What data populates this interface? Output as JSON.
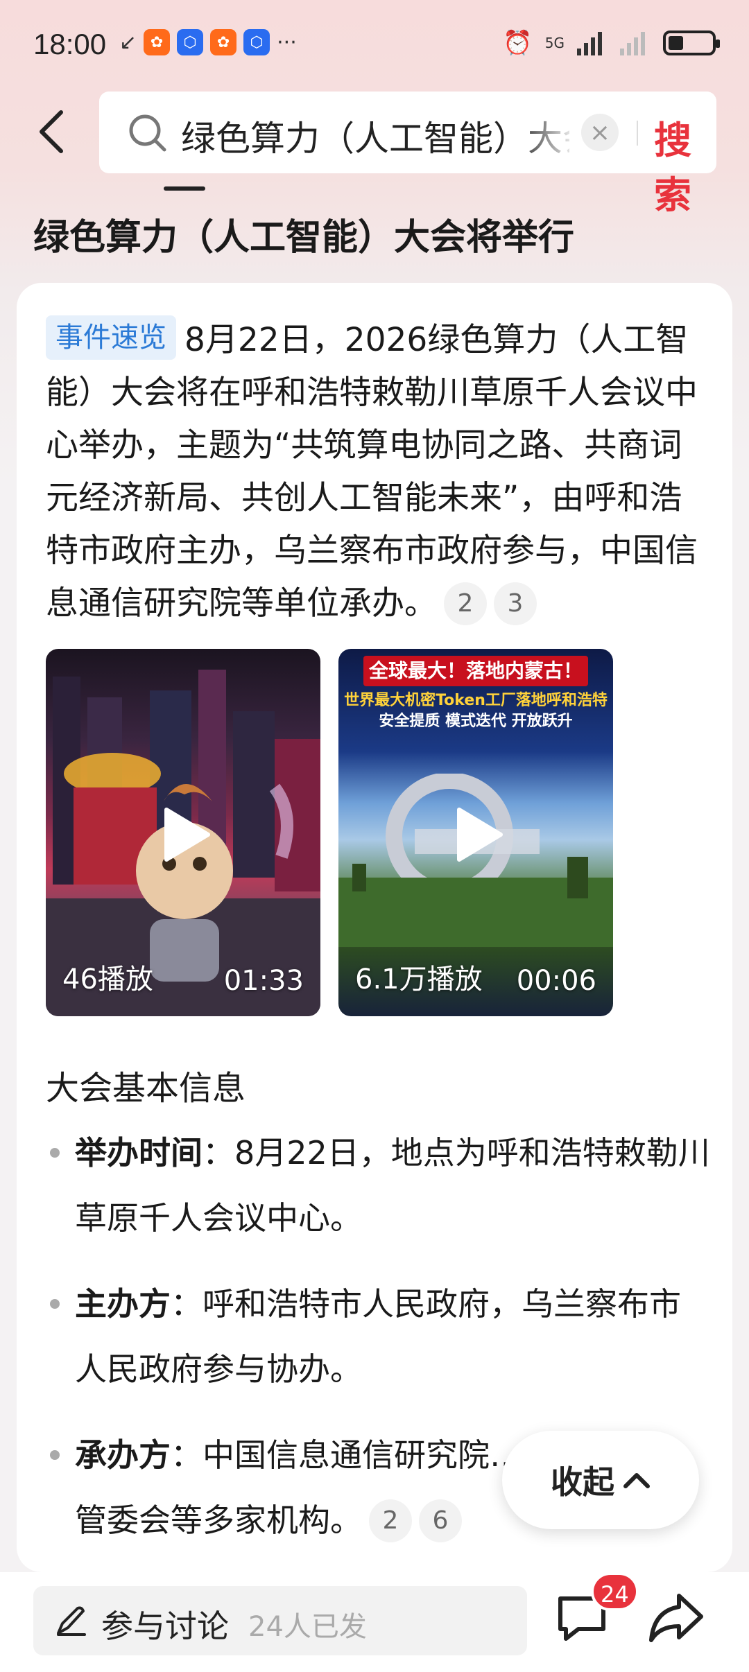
{
  "status_bar": {
    "time": "18:00",
    "network": "5G",
    "battery_level": 0.35
  },
  "header": {
    "search_query": "绿色算力（人工智能）大会将举行",
    "search_button": "搜索"
  },
  "page": {
    "title": "绿色算力（人工智能）大会将举行"
  },
  "summary": {
    "tag": "事件速览",
    "text": "8月22日，2026绿色算力（人工智能）大会将在呼和浩特敕勒川草原千人会议中心举办，主题为“共筑算电协同之路、共商词元经济新局、共创人工智能未来”，由呼和浩特市政府主办，乌兰察布市政府参与，中国信息通信研究院等单位承办。",
    "citations": [
      "2",
      "3"
    ]
  },
  "videos": [
    {
      "plays": "46播放",
      "duration": "01:33"
    },
    {
      "plays": "6.1万播放",
      "duration": "00:06",
      "banner_line1": "全球最大！落地内蒙古！",
      "banner_line2": "世界最大机密Token工厂落地呼和浩特",
      "banner_line3": "安全提质 模式迭代 开放跃升"
    }
  ],
  "basic_info": {
    "heading": "大会基本信息",
    "items": [
      {
        "label": "举办时间",
        "sep": "：",
        "text": "8月22日，地点为呼和浩特敕勒川草原千人会议中心。"
      },
      {
        "label": "主办方",
        "sep": "：",
        "text": "呼和浩特市人民政府，乌兰察布市人民政府参与协办。"
      },
      {
        "label": "承办方",
        "sep": "：",
        "text": "中国信息通信研究院…林格尔新区管委会等多家机构。"
      }
    ],
    "item3_citations": [
      "2",
      "6"
    ]
  },
  "collapse_button": "收起",
  "bottom_bar": {
    "comment_label": "参与讨论",
    "comment_count": "24人已发",
    "chat_badge": "24"
  }
}
